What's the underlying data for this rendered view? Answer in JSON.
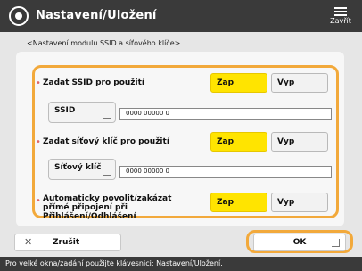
{
  "header": {
    "title": "Nastavení/Uložení",
    "close_label": "Zavřít"
  },
  "subtitle": "<Nastavení modulu SSID a síťového klíče>",
  "rows": [
    {
      "label": "Zadat SSID pro použití",
      "on_label": "Zap",
      "off_label": "Vyp",
      "selected": "on",
      "input_label": "SSID",
      "input_value": "0000 00000 0"
    },
    {
      "label": "Zadat síťový klíč pro použití",
      "on_label": "Zap",
      "off_label": "Vyp",
      "selected": "on",
      "input_label": "Síťový klíč",
      "input_value": "0000 00000 0"
    },
    {
      "label": "Automaticky povolit/zakázat přímé připojení při Přihlášení/Odhlášení",
      "on_label": "Zap",
      "off_label": "Vyp",
      "selected": "on"
    }
  ],
  "footer": {
    "cancel_label": "Zrušit",
    "ok_label": "OK"
  },
  "status_bar": {
    "text": "Pro velké okna/zadání použijte klávesnici: Nastavení/Uložení."
  },
  "colors": {
    "highlight": "#f2a93b",
    "selected_button": "#ffe400",
    "topbar": "#3a3a3a"
  },
  "icons": {
    "header_icon": "gear-icon",
    "close_icon": "menu-close-icon",
    "cancel_icon": "x-icon",
    "ok_corner_icon": "corner-arrow-icon",
    "input_corner_icon": "corner-arrow-icon"
  }
}
